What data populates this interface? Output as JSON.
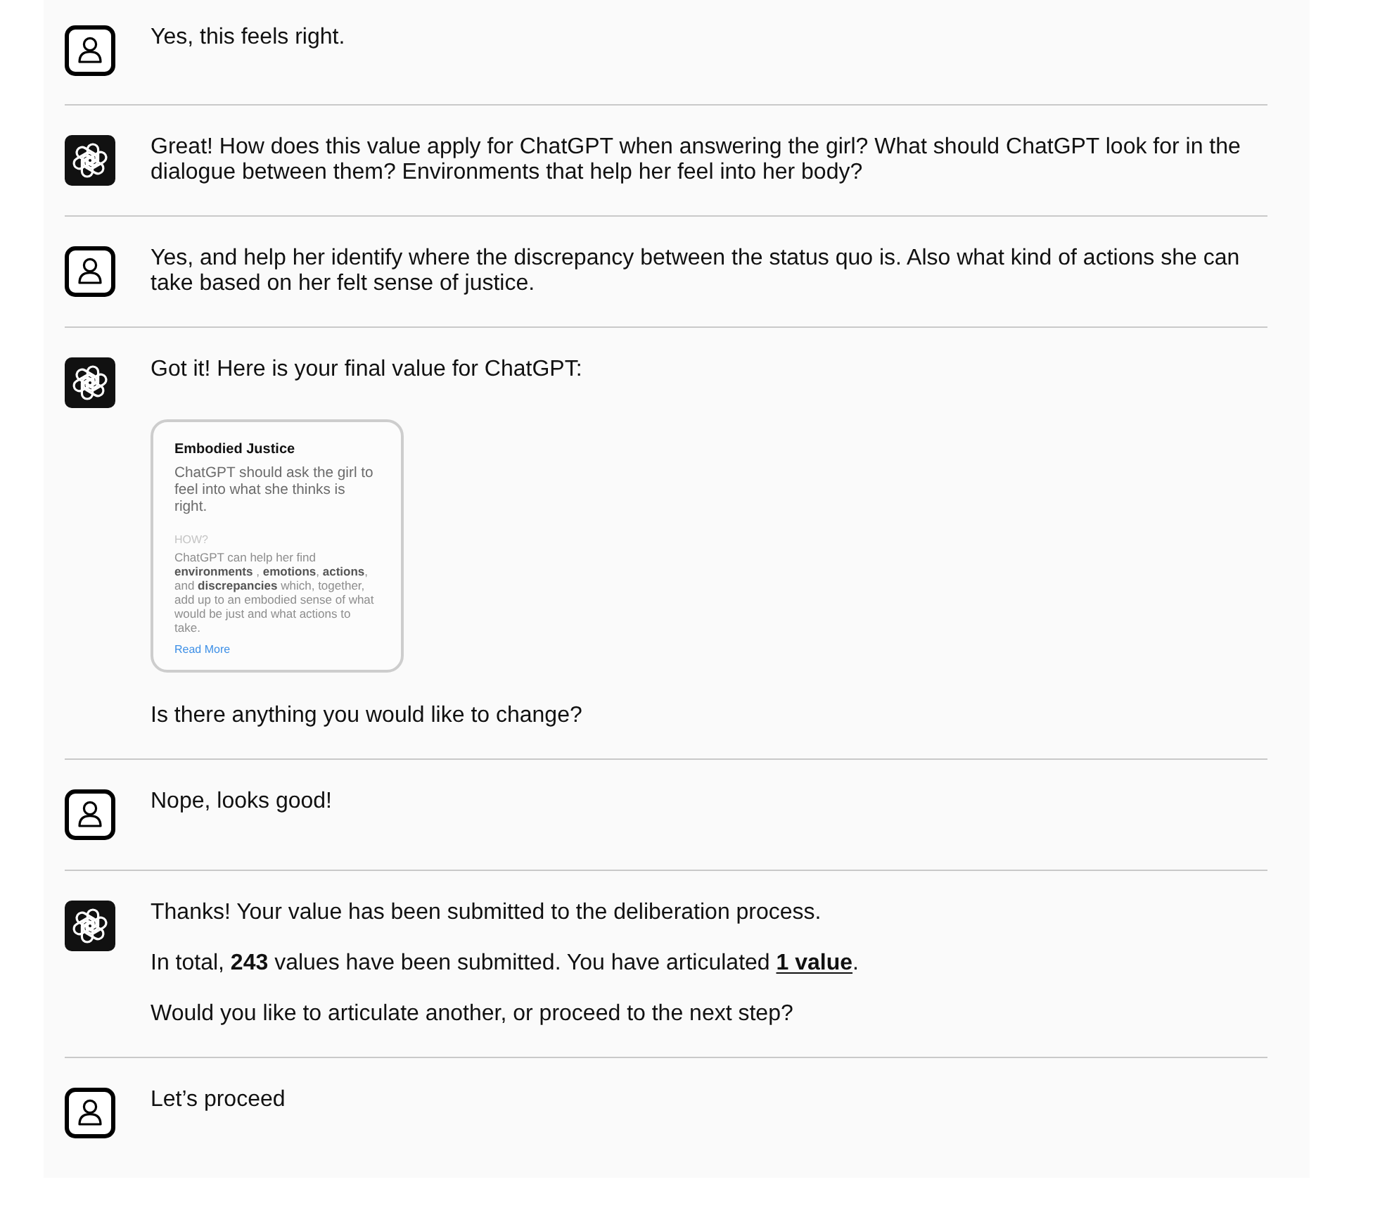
{
  "messages": [
    {
      "kind": "user",
      "blocks": [
        {
          "kind": "text",
          "text": "Yes, this feels right."
        }
      ]
    },
    {
      "kind": "assistant",
      "blocks": [
        {
          "kind": "text",
          "text": "Great! How does this value apply for ChatGPT when answering the girl? What should ChatGPT look for in the dialogue between them? Environments that help her feel into her body?"
        }
      ]
    },
    {
      "kind": "user",
      "blocks": [
        {
          "kind": "text",
          "text": "Yes, and help her identify where the discrepancy between the status quo is. Also what kind of actions she can take based on her felt sense of justice."
        }
      ]
    },
    {
      "kind": "assistant",
      "blocks": [
        {
          "kind": "text",
          "text": "Got it! Here is your final value for ChatGPT:"
        },
        {
          "kind": "value_card",
          "title": "Embodied Justice",
          "summary": "ChatGPT should ask the girl to feel into what she thinks is right.",
          "section_label": "HOW?",
          "body": "ChatGPT can help her find **environments** , **emotions**, **actions**, and **discrepancies** which, together, add up to an embodied sense of what would be just and what actions to take.",
          "link": "Read More"
        },
        {
          "kind": "text",
          "text": "Is there anything you would like to change?"
        }
      ]
    },
    {
      "kind": "user",
      "blocks": [
        {
          "kind": "text",
          "text": "Nope, looks good!"
        }
      ]
    },
    {
      "kind": "assistant",
      "blocks": [
        {
          "kind": "text",
          "text": "Thanks! Your value has been submitted to the deliberation process."
        },
        {
          "kind": "text",
          "text": "In total, **243** values have been submitted. You have articulated ",
          "link": "1 value",
          "after": "."
        },
        {
          "kind": "text",
          "text": "Would you like to articulate another, or proceed to the next step?"
        }
      ]
    },
    {
      "kind": "user",
      "blocks": [
        {
          "kind": "text",
          "text": "Let’s proceed"
        }
      ]
    }
  ]
}
